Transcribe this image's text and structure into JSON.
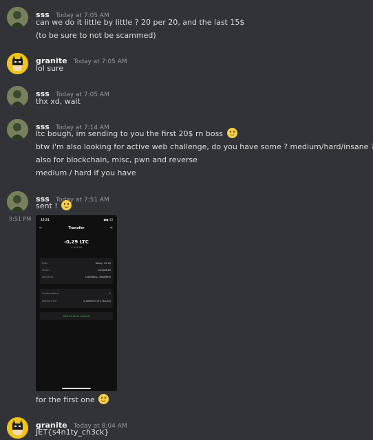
{
  "messages": [
    {
      "username": "sss",
      "timestamp": "Today at 7:05 AM",
      "lines": [
        "can we do it little by little ? 20 per 20, and the last 15$",
        "(to be sure to not be scammed)"
      ]
    },
    {
      "username": "granite",
      "timestamp": "Today at 7:05 AM",
      "lines": [
        "lol sure"
      ]
    },
    {
      "username": "sss",
      "timestamp": "Today at 7:05 AM",
      "lines": [
        "thx xd, wait"
      ]
    },
    {
      "username": "sss",
      "timestamp": "Today at 7:14 AM",
      "lines": [
        "ltc bough, im sending to you the first 20$ rn boss",
        "btw i'm also looking for active web challenge, do you have some ? medium/hard/insane ?",
        "also for blockchain, misc, pwn and reverse",
        "medium / hard if you have"
      ]
    },
    {
      "username": "sss",
      "timestamp": "Today at 7:51 AM",
      "lines": [
        "sent !"
      ],
      "side_time": "9:51 PM",
      "after_line": "for the first one"
    },
    {
      "username": "granite",
      "timestamp": "Today at 8:04 AM",
      "lines": [
        "JET{s4n1ty_ch3ck}"
      ]
    }
  ],
  "phone": {
    "status_time": "15:51",
    "status_icons": "●● 43",
    "back": "←",
    "share": "<",
    "title": "Transfer",
    "amount": "-0,29 LTC",
    "amount_sub": "≈ $15,94",
    "rows1": [
      {
        "label": "Date",
        "value": "Today, 15:49"
      },
      {
        "label": "Status",
        "value": "Completed"
      },
      {
        "label": "Recipient",
        "value": "LNj9zNep...9wd8Nfm"
      }
    ],
    "rows2": [
      {
        "label": "Confirmations",
        "value": "1"
      },
      {
        "label": "Network fee",
        "value": "0,0000073 LTC ($0,00)"
      }
    ],
    "link": "View on block explorer"
  },
  "colors": {
    "background": "#313338",
    "username": "#f2f3f5",
    "timestamp": "#949ba4",
    "text": "#dbdee1",
    "link_green": "#3fb65b"
  }
}
